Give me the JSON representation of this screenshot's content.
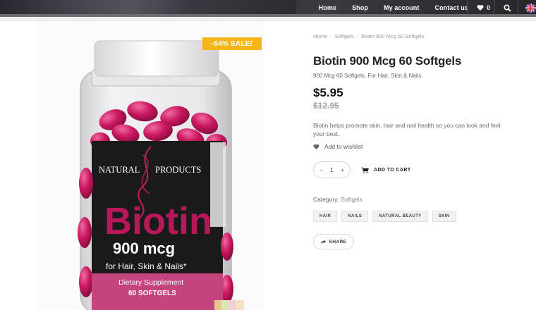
{
  "nav": {
    "items": [
      {
        "label": "Home"
      },
      {
        "label": "Shop"
      },
      {
        "label": "My account"
      },
      {
        "label": "Contact us"
      }
    ],
    "wishlist_count": "0"
  },
  "badge": {
    "sale": "-54% SALE!"
  },
  "breadcrumb": [
    "Home",
    "Softgels",
    "Biotin 900 Mcg 60 Softgels"
  ],
  "product": {
    "title": "Biotin 900 Mcg 60 Softgels",
    "subtitle": "900 Mcg 60 Softgels. For Hair, Skin & Nails.",
    "price": "$5.95",
    "old_price": "$12.95",
    "description": "Biotin helps promote skin, hair and nail health so you can look and feel your best.",
    "wishlist_label": "Add to wishlist",
    "quantity": "1",
    "qty_minus": "−",
    "qty_plus": "+",
    "add_to_cart": "ADD TO CART",
    "category_label": "Category:",
    "category_value": "Softgels",
    "tags": [
      "HAIR",
      "NAILS",
      "NATURAL BEAUTY",
      "SKIN"
    ],
    "share": "SHARE"
  },
  "bottle": {
    "brand_left": "NATURAL",
    "brand_right": "PRODUCTS",
    "name": "Biotin",
    "dose": "900 mcg",
    "for": "for Hair, Skin & Nails*",
    "supplement": "Dietary Supplement",
    "count": "60 SOFTGELS"
  },
  "colors": {
    "accent": "#f7b617",
    "capsule": "#c8175e",
    "label": "#1a1a1a"
  }
}
